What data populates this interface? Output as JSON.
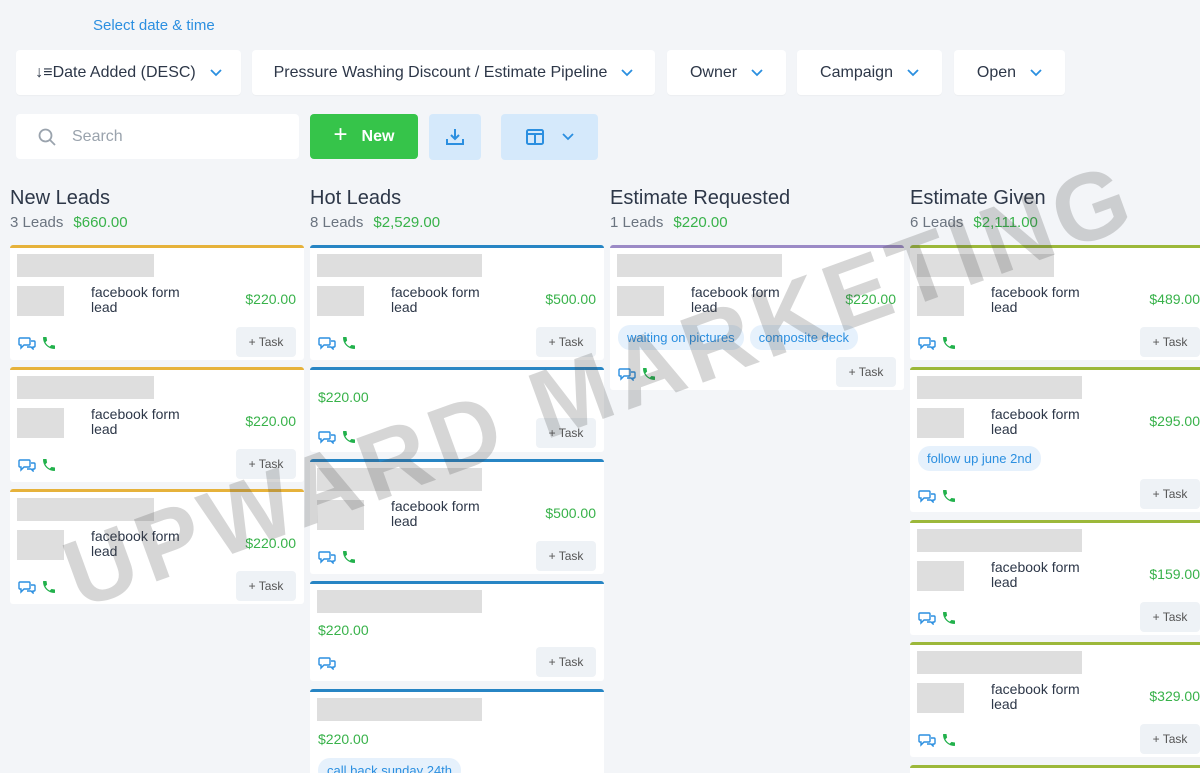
{
  "header": {
    "date_link": "Select date & time",
    "filters": [
      {
        "label": "↓≡Date Added (DESC)"
      },
      {
        "label": "Pressure Washing Discount / Estimate Pipeline"
      },
      {
        "label": "Owner"
      },
      {
        "label": "Campaign"
      },
      {
        "label": "Open"
      }
    ],
    "search_placeholder": "Search",
    "new_label": "New",
    "plus_glyph": "+"
  },
  "columns": [
    {
      "title": "New Leads",
      "count": "3 Leads",
      "amount": "$660.00",
      "color": "#e6b23b",
      "cards": [
        {
          "text": "facebook form lead",
          "price": "$220.00",
          "task": "+ Task"
        },
        {
          "text": "facebook form lead",
          "price": "$220.00",
          "task": "+ Task"
        },
        {
          "text": "facebook form lead",
          "price": "$220.00",
          "task": "+ Task"
        }
      ]
    },
    {
      "title": "Hot Leads",
      "count": "8 Leads",
      "amount": "$2,529.00",
      "color": "#2785c4",
      "cards": [
        {
          "text": "facebook form lead",
          "price": "$500.00",
          "task": "+ Task"
        },
        {
          "price": "$220.00",
          "task": "+ Task"
        },
        {
          "text": "facebook form lead",
          "price": "$500.00",
          "task": "+ Task"
        },
        {
          "price": "$220.00",
          "task": "+ Task"
        },
        {
          "price": "$220.00",
          "tags": [
            "call back sunday 24th"
          ]
        }
      ]
    },
    {
      "title": "Estimate Requested",
      "count": "1 Leads",
      "amount": "$220.00",
      "color": "#9b8ac6",
      "cards": [
        {
          "text": "facebook form lead",
          "price": "$220.00",
          "task": "+ Task",
          "tags": [
            "waiting on pictures",
            "composite deck"
          ]
        }
      ]
    },
    {
      "title": "Estimate Given",
      "count": "6 Leads",
      "amount": "$2,111.00",
      "color": "#9cb83a",
      "cards": [
        {
          "text": "facebook form lead",
          "price": "$489.00",
          "task": "+ Task"
        },
        {
          "text": "facebook form lead",
          "price": "$295.00",
          "task": "+ Task",
          "tags": [
            "follow up june 2nd"
          ]
        },
        {
          "text": "facebook form lead",
          "price": "$159.00",
          "task": "+ Task"
        },
        {
          "text": "facebook form lead",
          "price": "$329.00",
          "task": "+ Task"
        }
      ]
    }
  ],
  "watermark": "UPWARD MARKETING",
  "colors": {
    "accent_blue": "#2b8fe0",
    "green": "#38b24a",
    "new_button": "#36c44a",
    "icon_button_bg": "#d5e9fb"
  }
}
